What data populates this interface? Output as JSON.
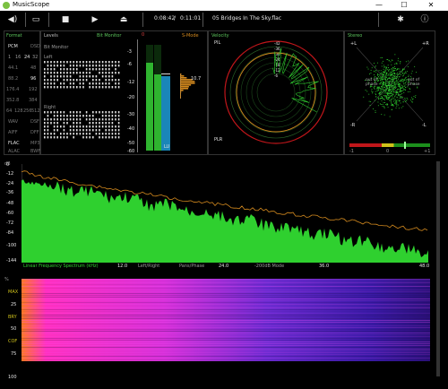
{
  "window": {
    "title": "MusicScope",
    "min": "—",
    "max": "☐",
    "close": "✕"
  },
  "toolbar": {
    "elapsed": "0:08:42",
    "sep": "/",
    "total": "0:11:01",
    "track": "05 Bridges In The Sky.flac",
    "icons": [
      "volume-icon",
      "folder-icon",
      "stop-icon",
      "play-icon",
      "eject-icon",
      "settings-icon",
      "info-icon"
    ]
  },
  "format": {
    "title": "Format",
    "rows": [
      [
        "PCM",
        "DSD"
      ],
      [
        "1",
        "16",
        "24",
        "32"
      ],
      [
        "44.1",
        "48"
      ],
      [
        "88.2",
        "96"
      ],
      [
        "176.4",
        "192"
      ],
      [
        "352.8",
        "384"
      ],
      [
        "64",
        "128",
        "256",
        "512"
      ],
      [
        "WAV",
        "DSF"
      ],
      [
        "AIFF",
        "DFF"
      ],
      [
        "FLAC",
        "MP3"
      ],
      [
        "ALAC",
        "BWF"
      ]
    ]
  },
  "levels": {
    "title": "Levels",
    "bit_monitor_link": "Bit Monitor",
    "bit_monitor_label": "Bit Monitor",
    "left": "Left",
    "right": "Right",
    "scale": [
      "-3",
      "-6",
      "-12",
      "-20",
      "-30",
      "-40",
      "-50",
      "-60"
    ],
    "peak_value": "10.7",
    "lu_label": "LU",
    "smode": "S-Mode",
    "zero": "0"
  },
  "stereo": {
    "title": "Stereo",
    "pl": "+L",
    "pr": "+R",
    "ml": "-R",
    "mr": "-L",
    "oop_left": "out of phase",
    "oop_right": "out of phase",
    "corr_min": "-1",
    "corr_zero": "0",
    "corr_max": "+1"
  },
  "velocity": {
    "title": "Velocity",
    "pil": "PIL",
    "plr": "PLR",
    "rings": [
      "-6",
      "-12",
      "-18",
      "-24",
      "-30",
      "-36",
      "-42",
      "-48",
      "-54",
      "-60"
    ]
  },
  "spectrum": {
    "y_ticks": [
      "0",
      "-12",
      "-24",
      "-36",
      "-48",
      "-60",
      "-72",
      "-84",
      "-100",
      "-144"
    ],
    "db_label": "dB",
    "footer": [
      "Linear Frequency Spectrum (kHz)",
      "Left/Right",
      "Pans/Phase",
      "-200dB Mode"
    ],
    "x_ticks": [
      "12.0",
      "24.0",
      "36.0",
      "48.0"
    ]
  },
  "spectrogram": {
    "percent": "%",
    "y_ticks": [
      "MAX",
      "25",
      "BRY",
      "50",
      "COF",
      "75",
      "100"
    ]
  },
  "colors": {
    "green": "#2fd02f",
    "orange": "#d48a1e",
    "blue": "#1a86b8",
    "magenta": "#ff00ff"
  }
}
